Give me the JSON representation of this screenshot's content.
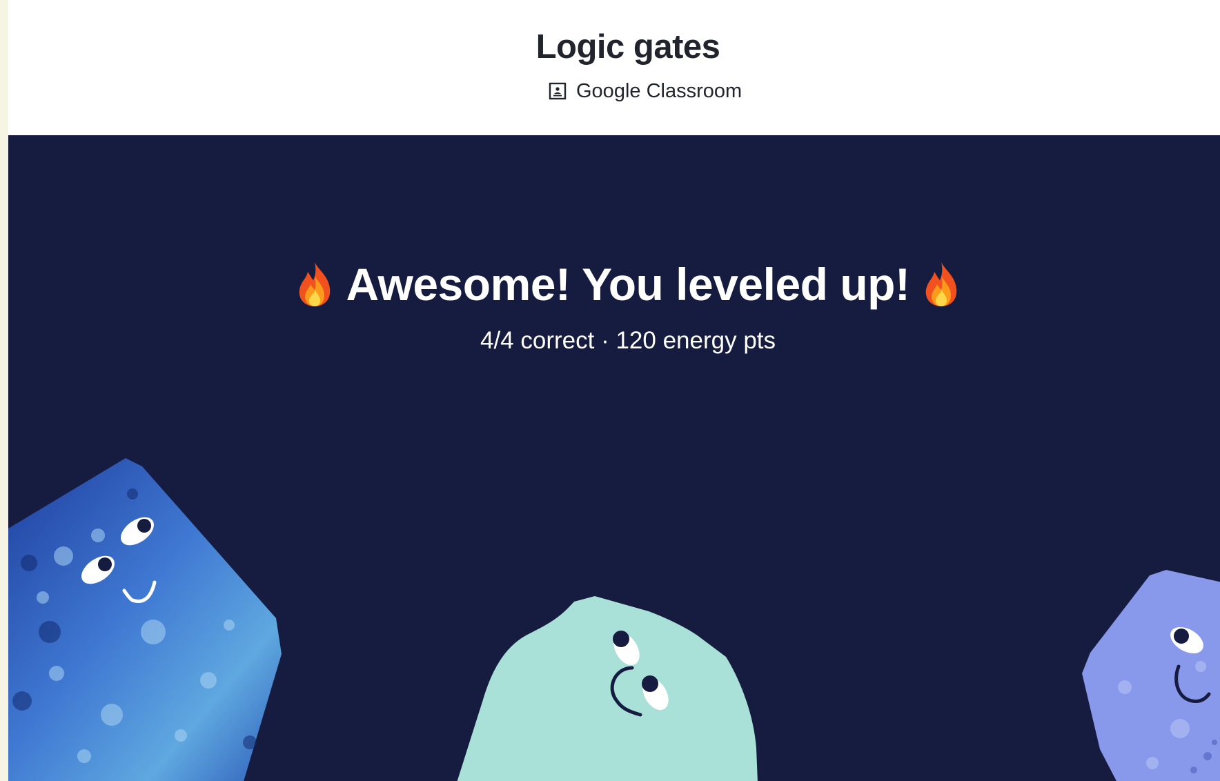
{
  "header": {
    "title": "Logic gates",
    "classroom_label": "Google Classroom",
    "classroom_icon": "google-classroom-icon"
  },
  "banner": {
    "headline": "Awesome! You leveled up!",
    "headline_icon": "fire-emoji",
    "correct": "4/4 correct",
    "separator": " · ",
    "energy": "120 energy pts"
  },
  "colors": {
    "banner_bg": "#161c3f",
    "title_text": "#21242c",
    "char_blue": "#3d6fc7",
    "char_mint": "#a9e0d8",
    "char_periwinkle": "#8898ea"
  }
}
